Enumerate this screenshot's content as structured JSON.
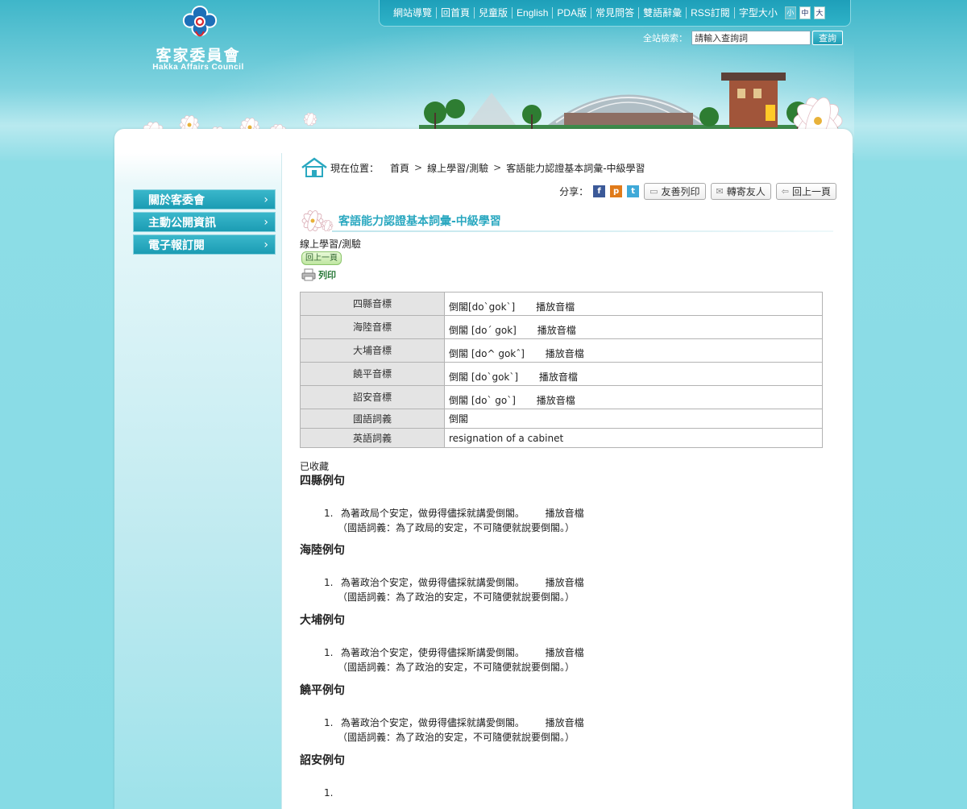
{
  "site": {
    "logo_cn": "客家委員會",
    "logo_en": "Hakka Affairs Council"
  },
  "topnav": {
    "items": [
      "網站導覽",
      "回首頁",
      "兒童版",
      "English",
      "PDA版",
      "常見問答",
      "雙語辭彙",
      "RSS訂閱",
      "字型大小"
    ],
    "font_sizes": [
      "小",
      "中",
      "大"
    ]
  },
  "search": {
    "label": "全站檢索：",
    "value": "請輸入查詢詞",
    "button": "查詢"
  },
  "sidebar": {
    "items": [
      {
        "label": "關於客委會"
      },
      {
        "label": "主動公開資訊"
      },
      {
        "label": "電子報訂閱"
      }
    ]
  },
  "breadcrumb": {
    "label": "現在位置：",
    "items": [
      "首頁",
      "線上學習/測驗",
      "客語能力認證基本詞彙-中級學習"
    ]
  },
  "tools": {
    "share_label": "分享：",
    "share_icons": [
      "facebook-icon",
      "plurk-icon",
      "twitter-icon"
    ],
    "friendly_print": "友善列印",
    "forward": "轉寄友人",
    "back": "回上一頁"
  },
  "page": {
    "title": "客語能力認證基本詞彙-中級學習",
    "subcategory": "線上學習/測驗",
    "back_small": "回上一頁",
    "print": "列印",
    "collected": "已收藏"
  },
  "word_table": [
    {
      "label": "四縣音標",
      "value": "倒閣[do`gok`]",
      "audio": "播放音檔"
    },
    {
      "label": "海陸音標",
      "value": "倒閣 [do´ gok]",
      "audio": "播放音檔"
    },
    {
      "label": "大埔音標",
      "value": "倒閣 [do^ gokˆ]",
      "audio": "播放音檔"
    },
    {
      "label": "饒平音標",
      "value": "倒閣 [do`gok`]",
      "audio": "播放音檔"
    },
    {
      "label": "詔安音標",
      "value": "倒閣 [do` go`]",
      "audio": "播放音檔"
    },
    {
      "label": "國語詞義",
      "value": "倒閣",
      "audio": ""
    },
    {
      "label": "英語詞義",
      "value": "resignation of a cabinet",
      "audio": ""
    }
  ],
  "examples": [
    {
      "title": "四縣例句",
      "num": "1.",
      "sentence": "為著政局个安定，做毋得儘採就講愛倒閣。",
      "audio": "播放音檔",
      "translation": "（國語詞義：為了政局的安定，不可隨便就說要倒閣。）"
    },
    {
      "title": "海陸例句",
      "num": "1.",
      "sentence": "為著政治个安定，做毋得儘採就講愛倒閣。",
      "audio": "播放音檔",
      "translation": "（國語詞義：為了政治的安定，不可隨便就說要倒閣。）"
    },
    {
      "title": "大埔例句",
      "num": "1.",
      "sentence": "為著政治个安定，使毋得儘採斯講愛倒閣。",
      "audio": "播放音檔",
      "translation": "（國語詞義：為了政治的安定，不可隨便就說要倒閣。）"
    },
    {
      "title": "饒平例句",
      "num": "1.",
      "sentence": "為著政治个安定，做毋得儘採就講愛倒閣。",
      "audio": "播放音檔",
      "translation": "（國語詞義：為了政治的安定，不可隨便就說要倒閣。）"
    },
    {
      "title": "詔安例句",
      "num": "1.",
      "sentence": "",
      "audio": "",
      "translation": ""
    }
  ],
  "colors": {
    "accent": "#2aa8c0",
    "nav_bg": "#1e9fb9",
    "menu_bg": "#1b9cb3",
    "page_bg": "#86dbe5"
  }
}
